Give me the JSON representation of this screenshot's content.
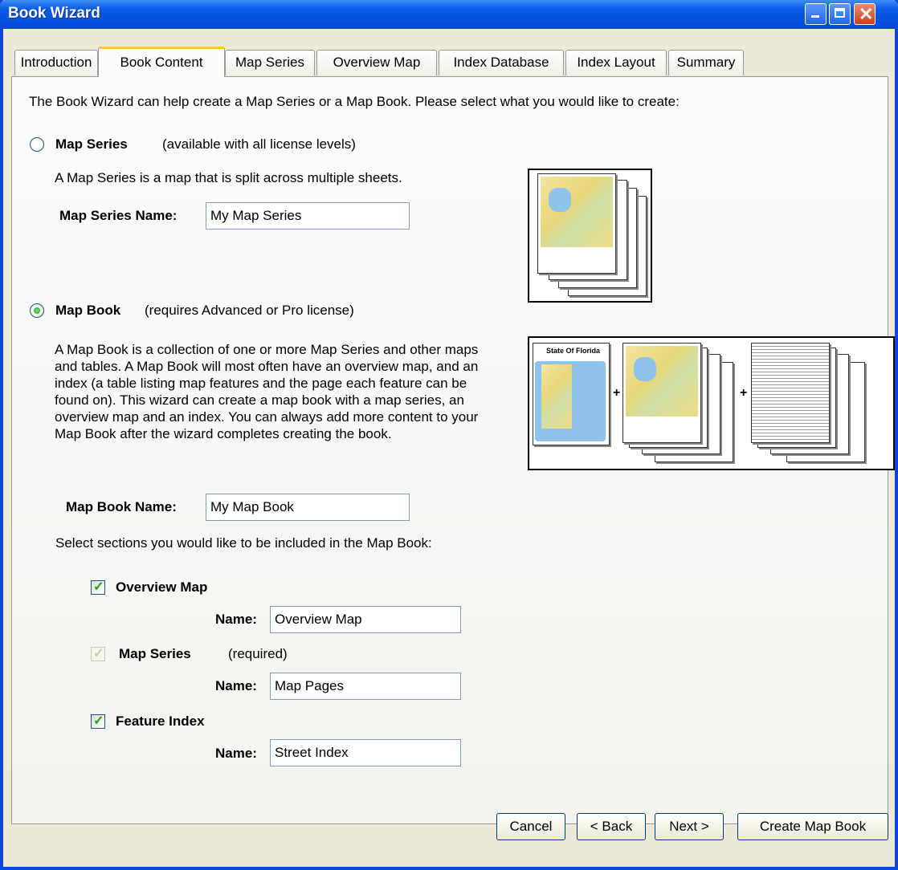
{
  "window": {
    "title": "Book Wizard"
  },
  "tabs": [
    "Introduction",
    "Book Content",
    "Map Series",
    "Overview Map",
    "Index Database",
    "Index Layout",
    "Summary"
  ],
  "content": {
    "intro": "The Book Wizard can help create a Map Series or a Map Book.  Please select what you would like to create:",
    "map_series_option": {
      "label": "Map Series",
      "note": "(available with all license levels)",
      "description": "A Map Series is a map that is split across multiple sheets.",
      "name_label": "Map Series Name:",
      "name_value": "My Map Series",
      "selected": false
    },
    "map_book_option": {
      "label": "Map Book",
      "note": "(requires Advanced or Pro license)",
      "description": "A Map Book is a collection of one or more Map Series and other maps and tables.  A Map Book will most often have an overview map, and an index (a table listing map features and the page each feature can be found on).  This wizard can create a map book with a map series, an overview map and an index.  You can always add more content to your Map Book after the wizard completes creating the book.",
      "name_label": "Map Book Name:",
      "name_value": "My Map Book",
      "selected": true
    },
    "preview_title": "State Of Florida",
    "sections_prompt": "Select sections you would like to be included in the Map Book:",
    "sections": {
      "overview": {
        "label": "Overview Map",
        "checked": true,
        "name_label": "Name:",
        "name_value": "Overview Map"
      },
      "series": {
        "label": "Map Series",
        "note": "(required)",
        "checked": true,
        "disabled": true,
        "name_label": "Name:",
        "name_value": "Map Pages"
      },
      "index": {
        "label": "Feature Index",
        "checked": true,
        "name_label": "Name:",
        "name_value": "Street Index"
      }
    }
  },
  "buttons": {
    "cancel": "Cancel",
    "back": "< Back",
    "next": "Next >",
    "create": "Create Map Book"
  },
  "icons": {
    "plus": "+",
    "check": "✓",
    "close": "✕"
  },
  "colors": {
    "titlebar": "#0a5ee8",
    "tab_highlight": "#ffc83c",
    "check": "#21a121"
  }
}
